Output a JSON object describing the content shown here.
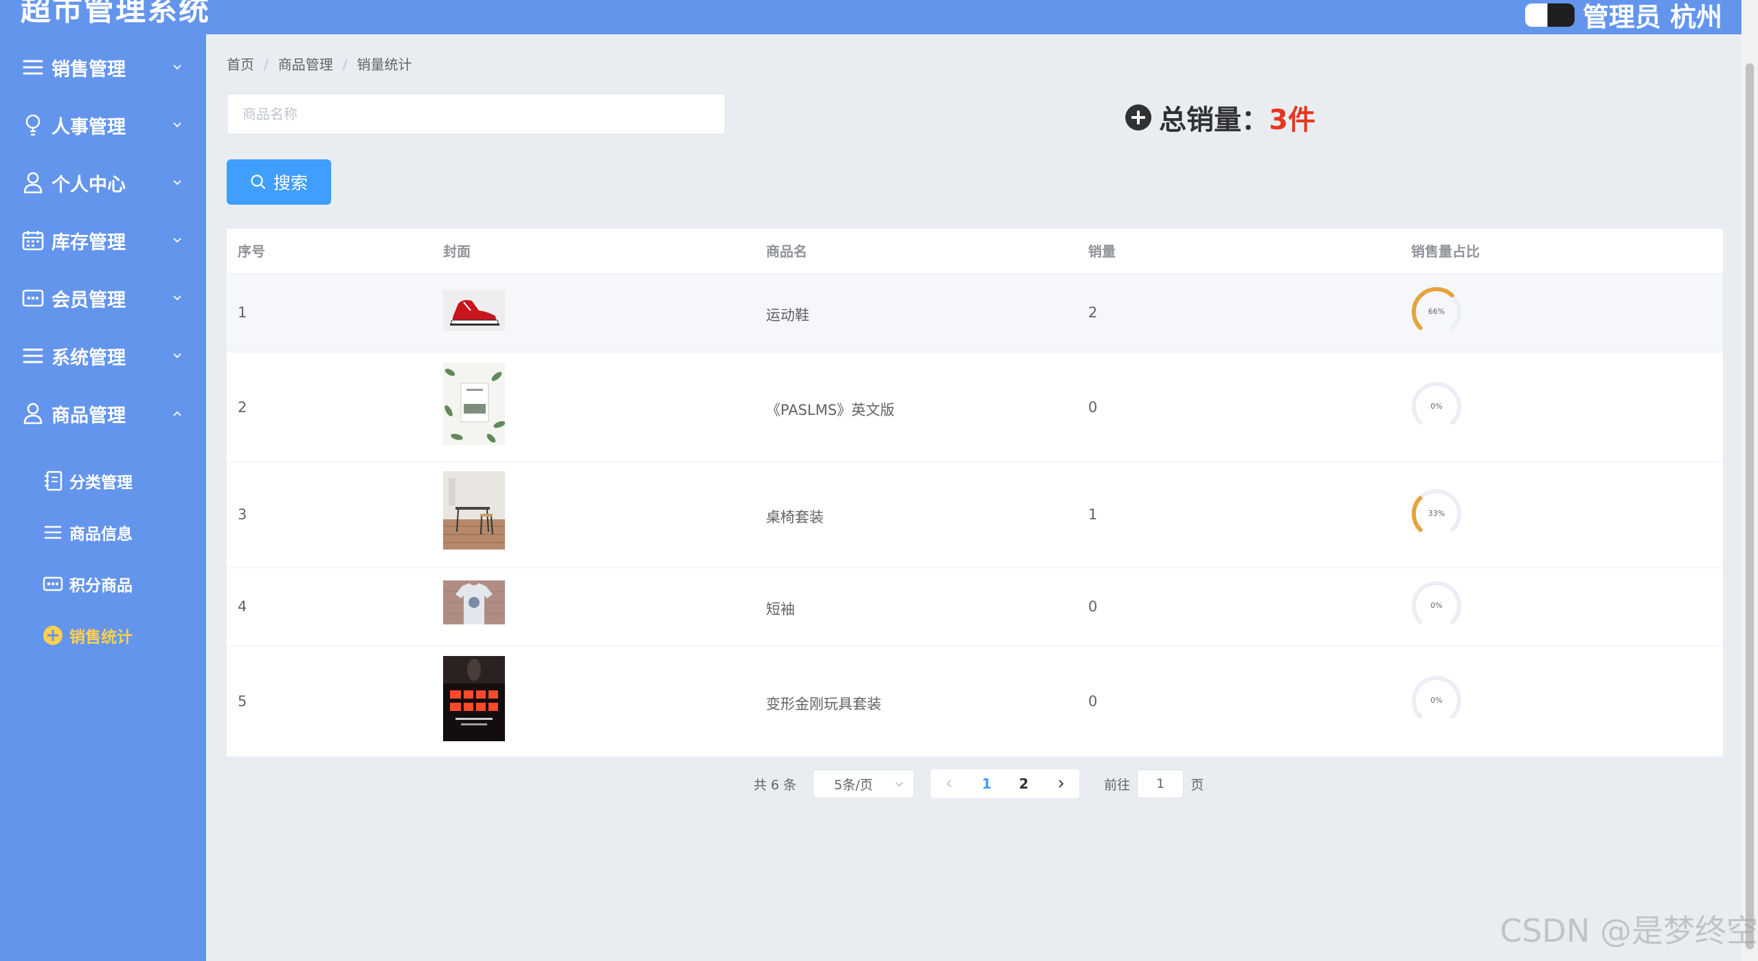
{
  "header": {
    "title": "超市管理系统",
    "user_text": "管理员 杭州"
  },
  "sidebar": {
    "menus": [
      {
        "label": "销售管理",
        "icon": "list-icon",
        "expanded": false
      },
      {
        "label": "人事管理",
        "icon": "lightbulb-icon",
        "expanded": false
      },
      {
        "label": "个人中心",
        "icon": "user-icon",
        "expanded": false
      },
      {
        "label": "库存管理",
        "icon": "calendar-icon",
        "expanded": false
      },
      {
        "label": "会员管理",
        "icon": "card-icon",
        "expanded": false
      },
      {
        "label": "系统管理",
        "icon": "list-icon",
        "expanded": false
      },
      {
        "label": "商品管理",
        "icon": "user-icon",
        "expanded": true
      }
    ],
    "submenus": [
      {
        "label": "分类管理",
        "icon": "notebook-icon"
      },
      {
        "label": "商品信息",
        "icon": "list-icon"
      },
      {
        "label": "积分商品",
        "icon": "card-icon"
      },
      {
        "label": "销售统计",
        "icon": "plus-circle-icon",
        "active": true
      }
    ],
    "active_color": "#ffd04b"
  },
  "breadcrumb": [
    "首页",
    "商品管理",
    "销量统计"
  ],
  "search": {
    "placeholder": "商品名称",
    "value": "",
    "button_label": "搜索"
  },
  "summary": {
    "label": "总销量：",
    "value": "3件",
    "value_color": "#e6371f"
  },
  "table": {
    "columns": [
      "序号",
      "封面",
      "商品名",
      "销量",
      "销售量占比"
    ],
    "rows": [
      {
        "index": "1",
        "cover": "red-sneaker-image",
        "name": "运动鞋",
        "sales": "2",
        "percent": 66,
        "percent_label": "66%"
      },
      {
        "index": "2",
        "cover": "book-leaves-image",
        "name": "《PASLMS》英文版",
        "sales": "0",
        "percent": 0,
        "percent_label": "0%"
      },
      {
        "index": "3",
        "cover": "desk-chair-image",
        "name": "桌椅套装",
        "sales": "1",
        "percent": 33,
        "percent_label": "33%"
      },
      {
        "index": "4",
        "cover": "tshirt-image",
        "name": "短袖",
        "sales": "0",
        "percent": 0,
        "percent_label": "0%"
      },
      {
        "index": "5",
        "cover": "neon-poster-image",
        "name": "变形金刚玩具套装",
        "sales": "0",
        "percent": 0,
        "percent_label": "0%"
      }
    ],
    "gauge_color": "#e6a23c",
    "gauge_track_color": "#ebeef5"
  },
  "pagination": {
    "total_text": "共 6 条",
    "page_size": "5条/页",
    "pages": [
      "1",
      "2"
    ],
    "current_page": "1",
    "goto_prefix": "前往",
    "goto_value": "1",
    "goto_suffix": "页"
  },
  "watermark": "CSDN @是梦终空"
}
